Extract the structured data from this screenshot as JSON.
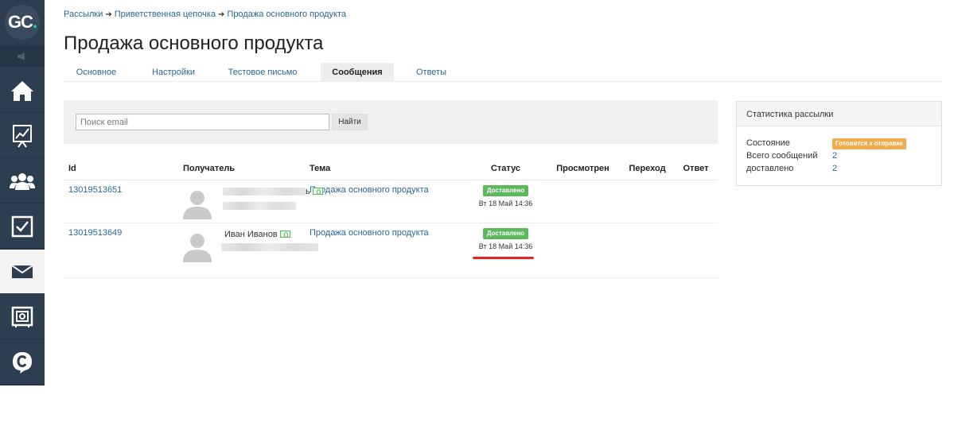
{
  "app": {
    "logo_text": "GC",
    "logo_dot": "."
  },
  "sidebar": {
    "items": [
      {
        "icon": "home-icon"
      },
      {
        "icon": "chart-icon"
      },
      {
        "icon": "users-icon"
      },
      {
        "icon": "checkbox-icon"
      },
      {
        "icon": "mail-icon",
        "active": true
      },
      {
        "icon": "safe-icon"
      },
      {
        "icon": "chat-icon"
      }
    ]
  },
  "breadcrumb": {
    "items": [
      "Рассылки",
      "Приветственная цепочка",
      "Продажа основного продукта"
    ],
    "separator": "➔"
  },
  "page": {
    "title": "Продажа основного продукта"
  },
  "tabs": [
    {
      "label": "Основное"
    },
    {
      "label": "Настройки"
    },
    {
      "label": "Тестовое письмо"
    },
    {
      "label": "Сообщения",
      "active": true
    },
    {
      "label": "Ответы"
    }
  ],
  "filter": {
    "search_placeholder": "Поиск email",
    "search_value": "",
    "search_button": "Найти"
  },
  "table": {
    "columns": [
      "Id",
      "Получатель",
      "Тема",
      "Статус",
      "Просмотрен",
      "Переход",
      "Ответ"
    ],
    "rows": [
      {
        "id": "13019513651",
        "recipient_name_suffix": "ь",
        "subject": "Продажа основного продукта",
        "status": "Доставлено",
        "status_date": "Вт 18 Май 14:36",
        "viewed": "",
        "clicked": "",
        "replied": ""
      },
      {
        "id": "13019513649",
        "recipient_name": "Иван Иванов",
        "subject": "Продажа основного продукта",
        "status": "Доставлено",
        "status_date": "Вт 18 Май 14:36",
        "viewed": "",
        "clicked": "",
        "replied": ""
      }
    ]
  },
  "stats": {
    "title": "Статистика рассылки",
    "state_label": "Состояние",
    "state_value": "Готовится к отправке",
    "total_label": "Всего сообщений",
    "total_value": "2",
    "delivered_label": "доставлено",
    "delivered_value": "2"
  },
  "colors": {
    "sidebar_bg": "#2d3e50",
    "link": "#2a6496",
    "success": "#5cb85c",
    "warning": "#f0ad4e",
    "highlight": "#e5221d",
    "logo_accent": "#1fd1b6"
  }
}
